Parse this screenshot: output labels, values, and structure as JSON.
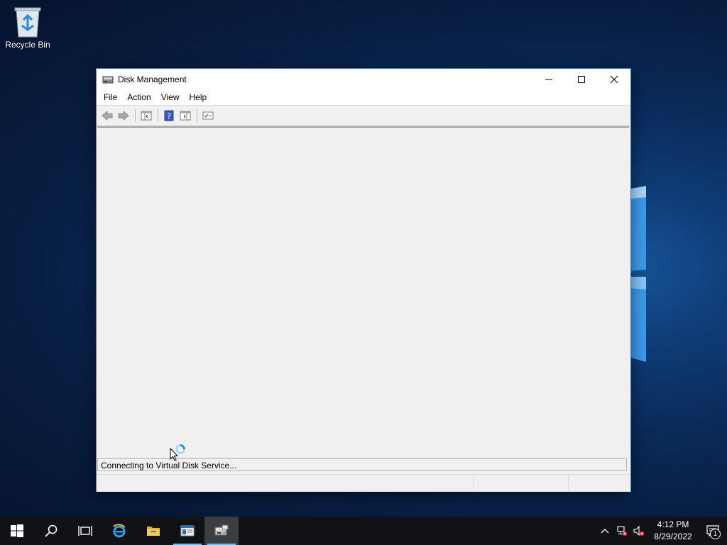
{
  "desktop": {
    "recycle_bin_label": "Recycle Bin"
  },
  "window": {
    "title": "Disk Management",
    "icon": "disk-management-icon",
    "menu": [
      {
        "label": "File"
      },
      {
        "label": "Action"
      },
      {
        "label": "View"
      },
      {
        "label": "Help"
      }
    ],
    "toolbar": [
      "back-arrow-icon",
      "forward-arrow-icon",
      "show-hide-console-tree-icon",
      "help-icon",
      "show-hide-action-pane-icon",
      "properties-icon"
    ],
    "connecting_text": "Connecting to Virtual Disk Service..."
  },
  "taskbar": {
    "apps": [
      "start-icon",
      "search-icon",
      "task-view-icon",
      "internet-explorer-icon",
      "file-explorer-icon",
      "server-manager-icon",
      "disk-management-icon"
    ],
    "time": "4:12 PM",
    "date": "8/29/2022",
    "notification_count": "1"
  },
  "colors": {
    "accent": "#0078d7",
    "taskbar": "#101215",
    "window_bg": "#f0f0f0"
  }
}
